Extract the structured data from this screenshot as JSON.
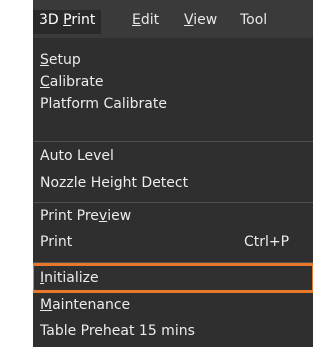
{
  "menubar": {
    "items": [
      {
        "prefix": "3D ",
        "mnemonic": "P",
        "rest": "rint"
      },
      {
        "prefix": "",
        "mnemonic": "E",
        "rest": "dit"
      },
      {
        "prefix": "",
        "mnemonic": "V",
        "rest": "iew"
      },
      {
        "prefix": "Tool",
        "mnemonic": "",
        "rest": ""
      }
    ]
  },
  "menu": {
    "setup": {
      "mnemonic": "S",
      "rest": "etup"
    },
    "calibrate": {
      "mnemonic": "C",
      "rest": "alibrate"
    },
    "platform_calibrate": "Platform Calibrate",
    "auto_level": "Auto Level",
    "nozzle_height_detect": "Nozzle Height Detect",
    "print_preview": {
      "pre": "Print Pre",
      "mnemonic": "v",
      "post": "iew"
    },
    "print": {
      "label": "Print",
      "shortcut": "Ctrl+P"
    },
    "initialize": {
      "mnemonic": "I",
      "rest": "nitialize"
    },
    "maintenance": {
      "mnemonic": "M",
      "rest": "aintenance"
    },
    "table_preheat": "Table Preheat 15 mins"
  },
  "colors": {
    "highlight_border": "#e8782b",
    "menu_background": "#2f2f2f"
  }
}
